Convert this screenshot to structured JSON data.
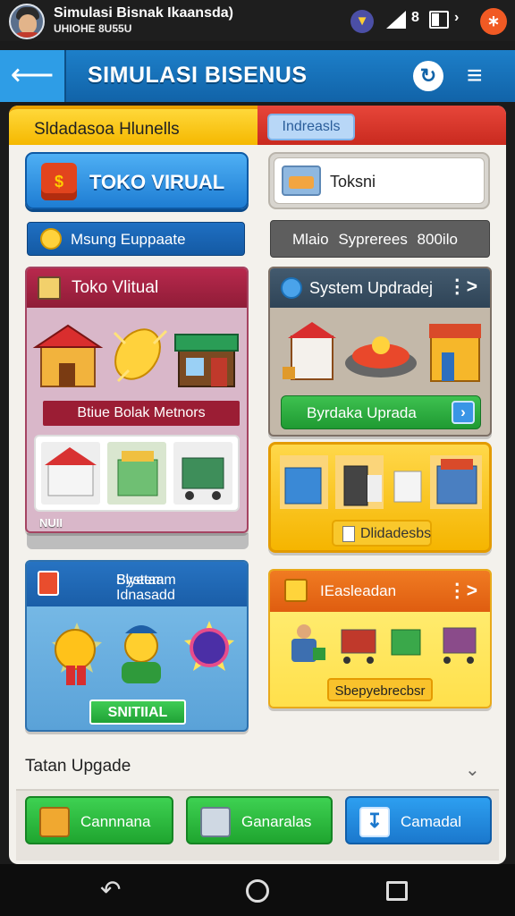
{
  "status_bar": {
    "app_title": "Simulasi Bisnak Ikaansda)",
    "app_subtitle": "UHIOHE 8U55U",
    "signal_number": "8"
  },
  "top_bar": {
    "back_label": "⇱",
    "title": "SIMULASI BISENUS"
  },
  "tabs": {
    "left_label": "Sldadasoa Hlunells",
    "right_label": "Indreasls"
  },
  "primary_button": {
    "label": "TOKO VIRUAL"
  },
  "search": {
    "value": "Toksni"
  },
  "badges": {
    "left": "Msung Euppaate",
    "right": "Mlaio Syprerees 800ilo"
  },
  "cards": {
    "toko_virtual": {
      "title": "Toko Vlitual",
      "stripe": "Btiue Bolak Metnors",
      "footer": "NUII"
    },
    "system_update": {
      "title": "System Updradej",
      "button": "Byrdaka Uprada"
    },
    "yellow_card": {
      "button": "Dlidadesbs"
    },
    "systemm": {
      "title_line1": "Systemm",
      "title_line2": "Blyetaa Idnasadd",
      "button": "SNITIIAL"
    },
    "easleadan": {
      "title": "IEasleadan",
      "button": "Sbepyebrecbsr"
    }
  },
  "section": {
    "title": "Tatan Upgade"
  },
  "actions": [
    {
      "label": "Cannnana"
    },
    {
      "label": "Ganaralas"
    },
    {
      "label": "Camadal"
    }
  ],
  "colors": {
    "topbar": "#1163a8",
    "tab_yellow": "#f5b800",
    "tab_red": "#c92a1f",
    "green": "#1fa52f",
    "blue": "#1b78cd"
  }
}
